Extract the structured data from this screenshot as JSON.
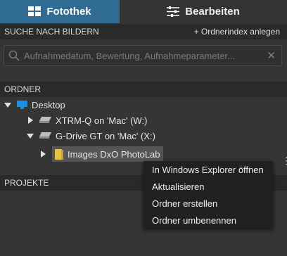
{
  "tabs": [
    {
      "label": "Fotothek",
      "icon": "library-icon",
      "active": true
    },
    {
      "label": "Bearbeiten",
      "icon": "sliders-icon",
      "active": false
    }
  ],
  "search_section": {
    "title": "SUCHE NACH BILDERN",
    "action": "+ Ordnerindex anlegen",
    "placeholder": "Aufnahmedatum, Bewertung, Aufnahmeparameter..."
  },
  "folders_section": {
    "title": "ORDNER",
    "tree": [
      {
        "label": "Desktop",
        "icon": "desktop-icon",
        "expanded": true,
        "level": 0
      },
      {
        "label": "XTRM-Q on 'Mac' (W:)",
        "icon": "drive-icon",
        "expanded": false,
        "level": 1
      },
      {
        "label": "G-Drive GT on 'Mac' (X:)",
        "icon": "drive-icon",
        "expanded": true,
        "level": 1
      },
      {
        "label": "Images DxO PhotoLab",
        "icon": "folder-icon",
        "expanded": false,
        "level": 2,
        "selected": true
      }
    ]
  },
  "projects_section": {
    "title": "PROJEKTE"
  },
  "context_menu": {
    "items": [
      "In Windows Explorer öffnen",
      "Aktualisieren",
      "Ordner erstellen",
      "Ordner umbenennen"
    ]
  },
  "colors": {
    "accent": "#2f6b93",
    "panel": "#353535",
    "header": "#2a2a2a",
    "menu": "#212121",
    "selection": "#555555"
  }
}
